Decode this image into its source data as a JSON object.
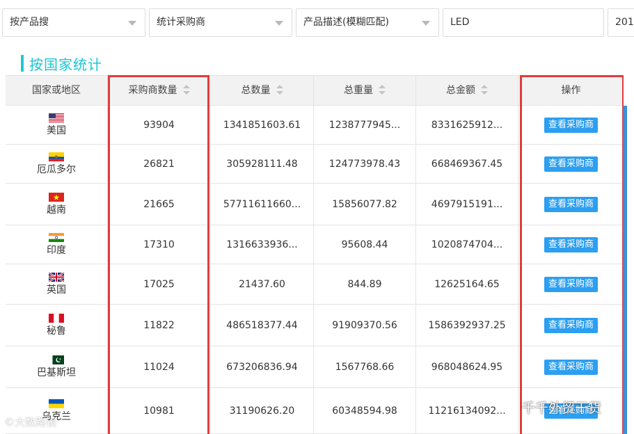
{
  "filters": {
    "product_search": "按产品搜",
    "buyer_stats": "统计采购商",
    "match_mode": "产品描述(模糊匹配)",
    "keyword": "LED",
    "year_partial": "201"
  },
  "section": {
    "title": "按国家统计"
  },
  "table": {
    "headers": {
      "country": "国家或地区",
      "buyers": "采购商数量",
      "total_qty": "总数量",
      "total_weight": "总重量",
      "total_amount": "总金额",
      "action": "操作"
    },
    "rows": [
      {
        "country": "美国",
        "flag": "us",
        "buyers": "93904",
        "qty": "1341851603.61",
        "weight": "1238777945...",
        "amount": "8331625912...",
        "action": "查看采购商"
      },
      {
        "country": "厄瓜多尔",
        "flag": "ec",
        "buyers": "26821",
        "qty": "305928111.48",
        "weight": "124773978.43",
        "amount": "668469367.45",
        "action": "查看采购商"
      },
      {
        "country": "越南",
        "flag": "vn",
        "buyers": "21665",
        "qty": "57711611660...",
        "weight": "15856077.82",
        "amount": "4697915191...",
        "action": "查看采购商"
      },
      {
        "country": "印度",
        "flag": "in",
        "buyers": "17310",
        "qty": "1316633936...",
        "weight": "95608.44",
        "amount": "1020874704...",
        "action": "查看采购商"
      },
      {
        "country": "英国",
        "flag": "gb",
        "buyers": "17025",
        "qty": "21437.60",
        "weight": "844.89",
        "amount": "12625164.65",
        "action": "查看采购商"
      },
      {
        "country": "秘鲁",
        "flag": "pe",
        "buyers": "11822",
        "qty": "486518377.44",
        "weight": "91909370.56",
        "amount": "1586392937.25",
        "action": "查看采购商"
      },
      {
        "country": "巴基斯坦",
        "flag": "pk",
        "buyers": "11024",
        "qty": "673206836.94",
        "weight": "1567768.66",
        "amount": "968048624.95",
        "action": "查看采购商"
      },
      {
        "country": "乌克兰",
        "flag": "ua",
        "buyers": "10981",
        "qty": "31190626.20",
        "weight": "60348594.98",
        "amount": "11216134092...",
        "action": "查看采购商"
      }
    ]
  },
  "watermarks": {
    "left": "©大数路镜",
    "right": "千千外贸干货"
  },
  "colors": {
    "accent_title": "#19c6d1",
    "button": "#2c9ff0",
    "highlight": "#e03c3c"
  }
}
